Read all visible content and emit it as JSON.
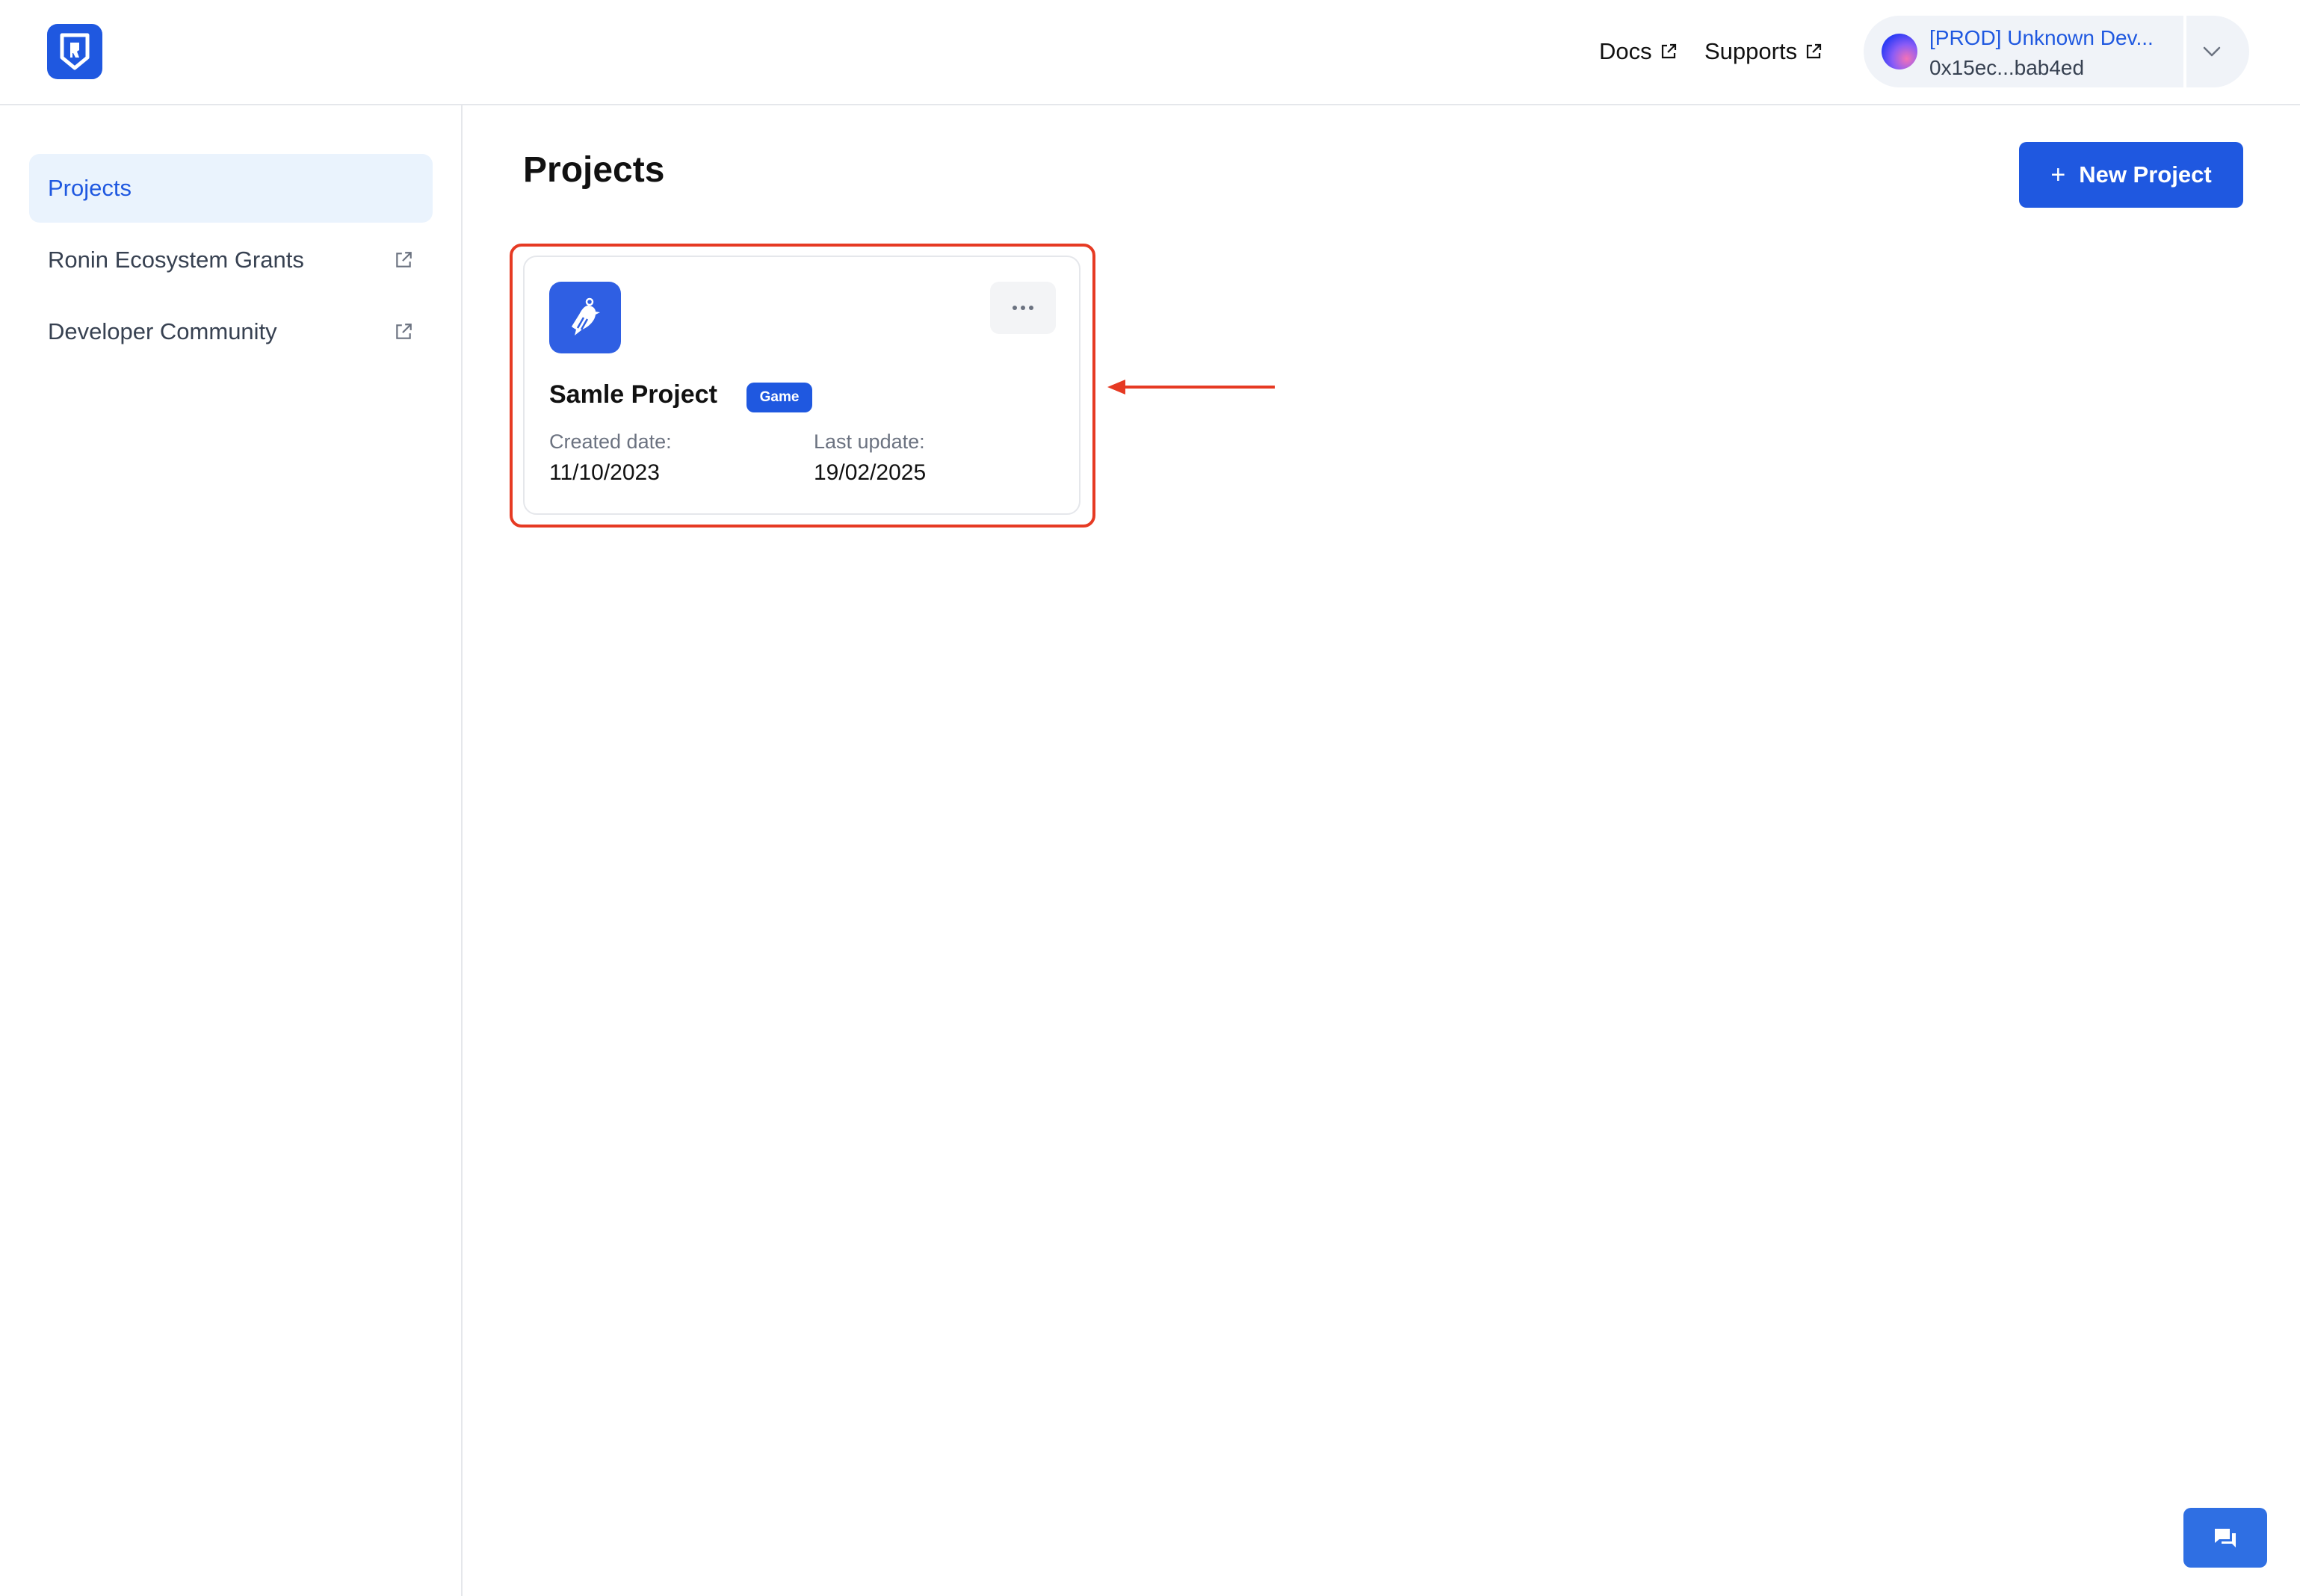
{
  "header": {
    "logo_icon": "ronin-shield-icon",
    "links": [
      {
        "label": "Docs",
        "icon": "external-link-icon"
      },
      {
        "label": "Supports",
        "icon": "external-link-icon"
      }
    ],
    "account": {
      "name": "[PROD] Unknown Dev...",
      "address": "0x15ec...bab4ed",
      "chevron_icon": "chevron-down-icon"
    }
  },
  "sidebar": {
    "items": [
      {
        "label": "Projects",
        "active": true
      },
      {
        "label": "Ronin Ecosystem Grants",
        "icon": "external-link-icon"
      },
      {
        "label": "Developer Community",
        "icon": "external-link-icon"
      }
    ]
  },
  "main": {
    "title": "Projects",
    "new_button": {
      "plus": "+",
      "label": "New Project"
    },
    "projects": [
      {
        "name": "Samle Project",
        "badge": "Game",
        "icon": "bird-icon",
        "created_label": "Created date:",
        "created_value": "11/10/2023",
        "updated_label": "Last update:",
        "updated_value": "19/02/2025"
      }
    ]
  },
  "annotation": {
    "color": "#e63a23"
  },
  "colors": {
    "accent": "#1f58e0",
    "sidebar_active_bg": "#eaf3fd"
  }
}
